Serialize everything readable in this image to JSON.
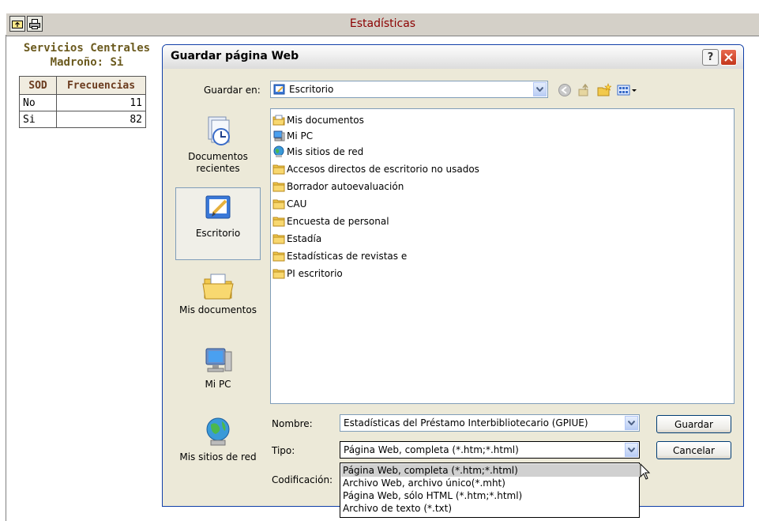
{
  "app": {
    "title": "Estadísticas",
    "toolbar": {
      "up_icon": "folder-up-icon",
      "print_icon": "printer-icon"
    }
  },
  "stats": {
    "title_line1": "Servicios Centrales",
    "title_line2": "Madroño: Si",
    "headers": [
      "SOD",
      "Frecuencias"
    ],
    "rows": [
      {
        "label": "No",
        "value": "11"
      },
      {
        "label": "Si",
        "value": "82"
      }
    ]
  },
  "dialog": {
    "title": "Guardar página Web",
    "help_label": "?",
    "save_in_label": "Guardar en:",
    "save_in_value": "Escritorio",
    "places": [
      {
        "label": "Documentos\nrecientes",
        "icon": "recent-documents-icon"
      },
      {
        "label": "Escritorio",
        "icon": "desktop-icon"
      },
      {
        "label": "Mis documentos",
        "icon": "my-documents-icon"
      },
      {
        "label": "Mi PC",
        "icon": "my-computer-icon"
      },
      {
        "label": "Mis sitios de red",
        "icon": "network-places-icon"
      }
    ],
    "files": [
      {
        "name": "Mis documentos",
        "icon": "my-documents-folder-icon"
      },
      {
        "name": "Mi PC",
        "icon": "my-computer-icon"
      },
      {
        "name": "Mis sitios de red",
        "icon": "network-places-icon"
      },
      {
        "name": "Accesos directos de escritorio no usados",
        "icon": "folder-icon"
      },
      {
        "name": "Borrador autoevaluación",
        "icon": "folder-icon"
      },
      {
        "name": "CAU",
        "icon": "folder-icon"
      },
      {
        "name": "Encuesta de personal",
        "icon": "folder-icon"
      },
      {
        "name": "Estadía",
        "icon": "folder-icon"
      },
      {
        "name": "Estadísticas de revistas e",
        "icon": "folder-icon"
      },
      {
        "name": "PI escritorio",
        "icon": "folder-icon"
      }
    ],
    "name_label": "Nombre:",
    "name_value": "Estadísticas del Préstamo Interbibliotecario (GPIUE)",
    "type_label": "Tipo:",
    "type_value": "Página Web, completa (*.htm;*.html)",
    "encoding_label": "Codificación:",
    "save_button": "Guardar",
    "cancel_button": "Cancelar",
    "type_options": [
      "Página Web, completa (*.htm;*.html)",
      "Archivo Web, archivo único(*.mht)",
      "Página Web, sólo HTML (*.htm;*.html)",
      "Archivo de texto (*.txt)"
    ],
    "highlight_color": "#d0d0d0",
    "title_color": "#8b0000"
  }
}
